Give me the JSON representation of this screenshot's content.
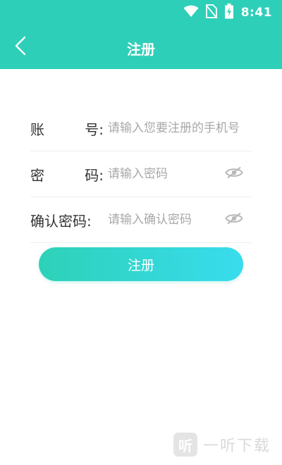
{
  "status_bar": {
    "time": "8:41",
    "icons": [
      "wifi-icon",
      "no-sim-icon",
      "battery-charging-icon"
    ]
  },
  "nav": {
    "back_icon": "chevron-left-icon",
    "title": "注册"
  },
  "form": {
    "account": {
      "label_left": "账",
      "label_right": "号:",
      "placeholder": "请输入您要注册的手机号"
    },
    "password": {
      "label_left": "密",
      "label_right": "码:",
      "placeholder": "请输入密码",
      "toggle_icon": "eye-off-icon"
    },
    "confirm_password": {
      "label": "确认密码:",
      "placeholder": "请输入确认密码",
      "toggle_icon": "eye-off-icon"
    }
  },
  "submit_label": "注册",
  "watermark": {
    "logo_glyph": "听",
    "text": "一听下载"
  },
  "colors": {
    "accent": "#2ecfb8",
    "button_gradient_start": "#2ed1b7",
    "button_gradient_end": "#38dcee",
    "placeholder": "#a8a8a8",
    "label": "#333333",
    "divider": "#eeeeee"
  }
}
